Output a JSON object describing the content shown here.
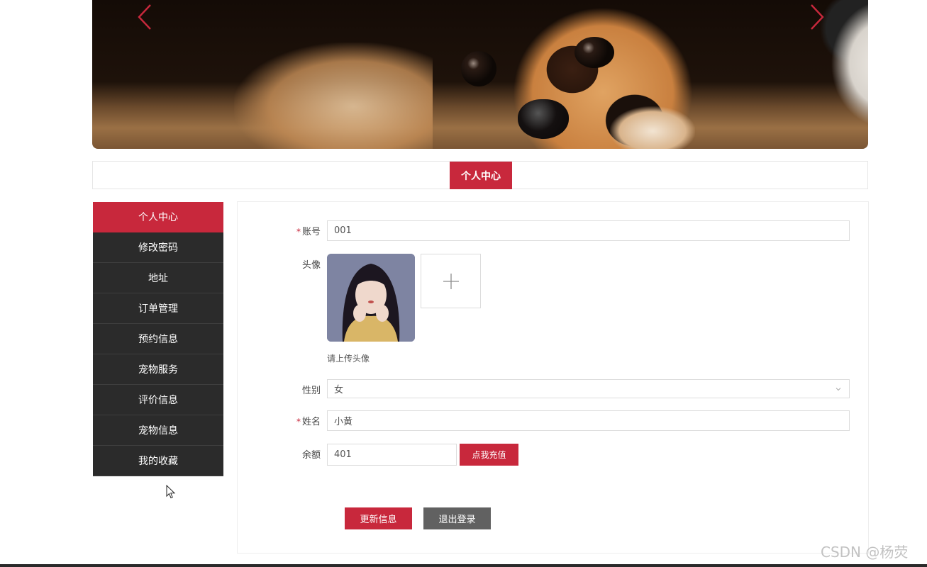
{
  "banner": {
    "prev_icon": "chevron-left-icon",
    "next_icon": "chevron-right-icon"
  },
  "page_title": "个人中心",
  "sidebar": {
    "items": [
      {
        "label": "个人中心",
        "active": true
      },
      {
        "label": "修改密码"
      },
      {
        "label": "地址"
      },
      {
        "label": "订单管理"
      },
      {
        "label": "预约信息"
      },
      {
        "label": "宠物服务"
      },
      {
        "label": "评价信息"
      },
      {
        "label": "宠物信息"
      },
      {
        "label": "我的收藏"
      }
    ]
  },
  "form": {
    "account": {
      "required_mark": "*",
      "label": "账号",
      "value": "001"
    },
    "avatar": {
      "label": "头像",
      "hint": "请上传头像",
      "upload_icon": "plus-icon"
    },
    "gender": {
      "label": "性别",
      "value": "女"
    },
    "name": {
      "required_mark": "*",
      "label": "姓名",
      "value": "小黄"
    },
    "balance": {
      "label": "余额",
      "value": "401",
      "recharge_label": "点我充值"
    },
    "update_label": "更新信息",
    "logout_label": "退出登录"
  },
  "watermark": "CSDN @杨荧",
  "colors": {
    "accent": "#c8283c",
    "sidebar_bg": "#2b2b2b",
    "secondary_button": "#616161"
  }
}
